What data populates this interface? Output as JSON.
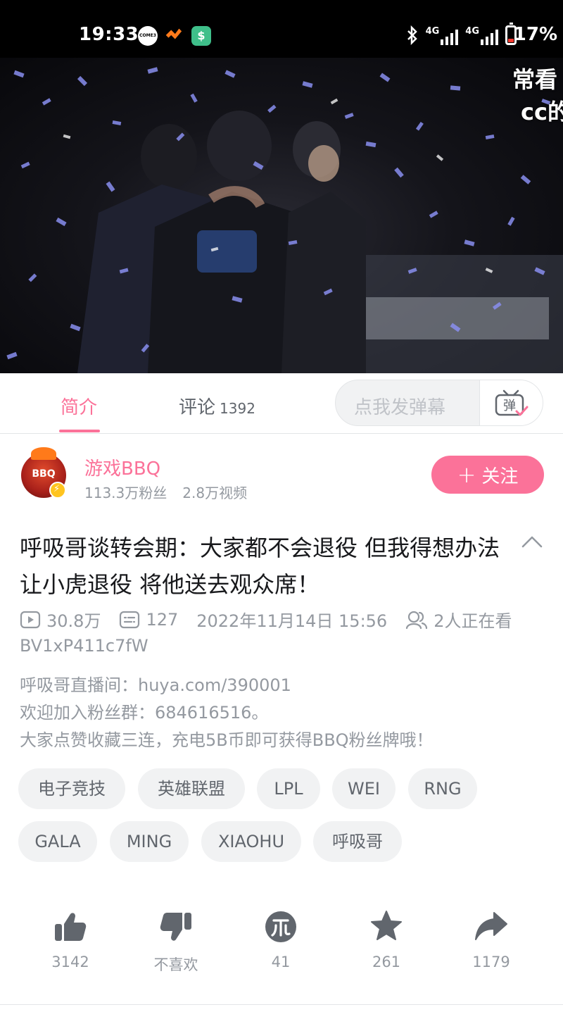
{
  "status_bar": {
    "time": "19:33",
    "come_icon_text": "COME3",
    "network_1": "4G",
    "network_2": "4G",
    "battery": "17%"
  },
  "video": {
    "danmaku": [
      "常看",
      "cc的"
    ]
  },
  "tabs": {
    "intro_label": "简介",
    "comments_label": "评论",
    "comments_count": "1392"
  },
  "danmaku_input": {
    "placeholder": "点我发弹幕",
    "toggle_label": "弹"
  },
  "uploader": {
    "avatar_text": "BBQ",
    "name": "游戏BBQ",
    "followers": "113.3万粉丝",
    "videos": "2.8万视频",
    "follow_plus": "+",
    "follow_label": "关注"
  },
  "video_info": {
    "title": "呼吸哥谈转会期：大家都不会退役 但我得想办法让小虎退役 将他送去观众席！",
    "views": "30.8万",
    "danmaku_count": "127",
    "publish_time": "2022年11月14日 15:56",
    "watching": "2人正在看",
    "bvid": "BV1xP411c7fW"
  },
  "description": [
    "呼吸哥直播间：huya.com/390001",
    "欢迎加入粉丝群：684616516。",
    "大家点赞收藏三连，充电5B币即可获得BBQ粉丝牌哦！"
  ],
  "tags": [
    "电子竞技",
    "英雄联盟",
    "LPL",
    "WEI",
    "RNG",
    "GALA",
    "MING",
    "XIAOHU",
    "呼吸哥"
  ],
  "actions": {
    "like": "3142",
    "dislike": "不喜欢",
    "coin": "41",
    "favorite": "261",
    "share": "1179"
  },
  "colors": {
    "accent": "#fb7299",
    "text_primary": "#18191c",
    "text_secondary": "#9499a0",
    "tag_bg": "#f1f2f3"
  }
}
